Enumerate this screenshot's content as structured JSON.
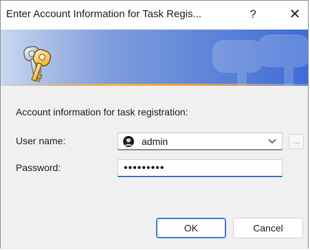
{
  "window": {
    "title": "Enter Account Information for Task Regis...",
    "help_icon": "question-mark",
    "close_icon": "close-x"
  },
  "banner": {
    "icon": "keys-icon",
    "watermark": "keys-watermark",
    "accent_color": "#f7a23b"
  },
  "form": {
    "section_label": "Account information for task registration:",
    "username_label": "User name:",
    "username_value": "admin",
    "username_icon": "user-avatar-icon",
    "browse_label": "...",
    "password_label": "Password:",
    "password_value": "•••••••••"
  },
  "buttons": {
    "ok": "OK",
    "cancel": "Cancel"
  },
  "colors": {
    "focus_blue": "#3a6fc7",
    "dialog_bg": "#f0f0f0"
  }
}
